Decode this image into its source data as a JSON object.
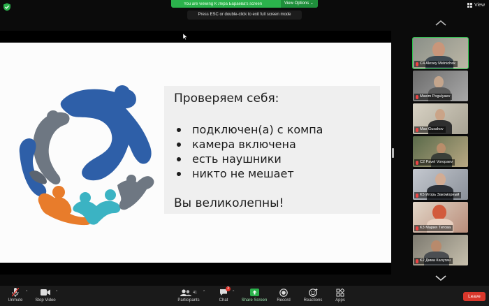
{
  "top_bar": {
    "viewing_text": "You are viewing К Лера Бараева's screen",
    "view_options_label": "View Options",
    "esc_hint": "Press ESC or double-click to exit full screen mode",
    "view_label": "View"
  },
  "slide": {
    "heading": "Проверяем себя:",
    "bullets": [
      "подключен(а) с компа",
      "камера включена",
      "есть наушники",
      "никто не мешает"
    ],
    "footer": "Вы великолепны!",
    "logo_colors": {
      "blue": "#2e5fa8",
      "gray": "#6e7782",
      "orange": "#e87c2b",
      "teal": "#3bb3c3"
    }
  },
  "participants": [
    {
      "name": "C4 Alexey Melnichek",
      "active": true
    },
    {
      "name": "Maxim Pogulyaev",
      "active": false
    },
    {
      "name": "Max Gusakov",
      "active": false
    },
    {
      "name": "C2 Pavel Voropaev",
      "active": false
    },
    {
      "name": "K5 Игорь Закоморный",
      "active": false
    },
    {
      "name": "K3 Мария Титова",
      "active": false
    },
    {
      "name": "K2 Дима Калугин",
      "active": false
    }
  ],
  "toolbar": {
    "unmute": "Unmute",
    "stop_video": "Stop Video",
    "participants": "Participants",
    "participants_count": "41",
    "chat": "Chat",
    "chat_badge": "3",
    "share_screen": "Share Screen",
    "record": "Record",
    "reactions": "Reactions",
    "apps": "Apps",
    "leave": "Leave"
  },
  "colors": {
    "accent_green": "#2bb24c",
    "leave_red": "#d9372b"
  }
}
